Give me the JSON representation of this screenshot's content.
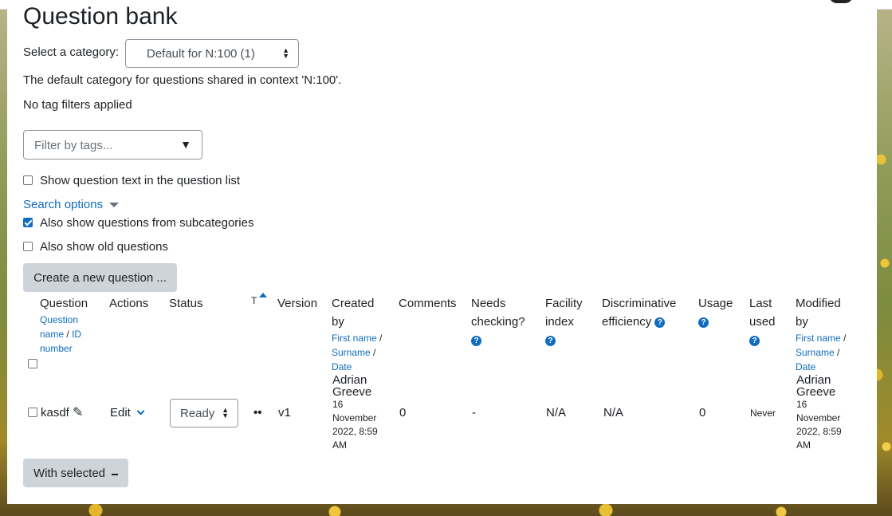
{
  "page": {
    "title": "Question bank",
    "category_label": "Select a category:",
    "category_value": "Default for N:100 (1)",
    "category_note": "The default category for questions shared in context 'N:100'.",
    "tag_filter_note": "No tag filters applied",
    "tags_placeholder": "Filter by tags...",
    "show_text_label": "Show question text in the question list",
    "show_text_checked": false,
    "search_options": "Search options",
    "subcat_label": "Also show questions from subcategories",
    "subcat_checked": true,
    "old_label": "Also show old questions",
    "old_checked": false,
    "create_button": "Create a new question ...",
    "with_selected": "With selected"
  },
  "table": {
    "headers": {
      "question": "Question",
      "question_sort_a": "Question",
      "question_sort_a2": "name",
      "question_sort_sep": "/",
      "question_sort_b": "ID",
      "question_sort_b2": "number",
      "actions": "Actions",
      "status": "Status",
      "type": "T",
      "version": "Version",
      "created_a": "Created",
      "created_b": "by",
      "first_name": "First name",
      "slash": "/",
      "surname": "Surname",
      "date": "Date",
      "comments": "Comments",
      "needs_a": "Needs",
      "needs_b": "checking?",
      "facility_a": "Facility",
      "facility_b": "index",
      "disc_a": "Discriminative",
      "disc_b": "efficiency",
      "usage": "Usage",
      "last_a": "Last",
      "last_b": "used",
      "modified_a": "Modified",
      "modified_b": "by"
    },
    "row": {
      "name": "kasdf",
      "edit": "Edit",
      "status": "Ready",
      "type_icon": "••",
      "version": "v1",
      "created_name1": "Adrian",
      "created_name2": "Greeve",
      "created_d1": "16",
      "created_d2": "November",
      "created_d3": "2022, 8:59",
      "created_d4": "AM",
      "comments": "0",
      "needs": "-",
      "facility": "N/A",
      "disc": "N/A",
      "usage": "0",
      "last": "Never",
      "modified_name1": "Adrian",
      "modified_name2": "Greeve",
      "modified_d1": "16",
      "modified_d2": "November",
      "modified_d3": "2022, 8:59",
      "modified_d4": "AM"
    }
  },
  "icons": {
    "help": "?",
    "pencil": "✎",
    "caret_down": "⌄"
  },
  "colors": {
    "link": "#0f6cbf",
    "button_grey": "#ced4da"
  }
}
